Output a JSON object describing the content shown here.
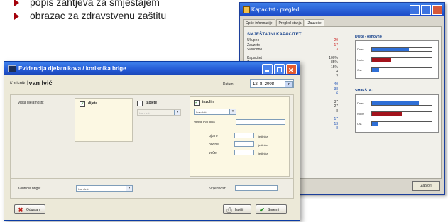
{
  "bullets": [
    "popis zahtjeva za smještajem",
    "obrazac za zdravstvenu zaštitu"
  ],
  "back_window": {
    "title": "Kapacitet - pregled",
    "tabs": [
      "Opće informacije",
      "Pregled stanja",
      "Zauzeće"
    ],
    "left_header": "SMJEŠTAJNI KAPACITET",
    "stats_group_1": [
      {
        "label": "Ukupno",
        "value": "20",
        "color": "red"
      },
      {
        "label": "Zauzeto",
        "value": "17",
        "color": "red"
      },
      {
        "label": "Slobodno",
        "value": "3",
        "color": "red"
      }
    ],
    "stats_group_2": [
      {
        "label": "Kapacitet",
        "value": "100%"
      },
      {
        "label": "Zauzeće",
        "value": "85%"
      },
      {
        "label": "Slobodno",
        "value": "15%"
      },
      {
        "label": "Na čekanju",
        "value": "4"
      },
      {
        "label": "Otpušteno",
        "value": "2"
      }
    ],
    "stats_group_3": [
      {
        "label": "Muškarci",
        "value": "40",
        "color": "blue"
      },
      {
        "label": "Žene",
        "value": "38",
        "color": "blue"
      },
      {
        "label": "Djeca",
        "value": "6",
        "color": "blue"
      }
    ],
    "stats_group_4": [
      {
        "label": "Zaposleni",
        "value": "37"
      },
      {
        "label": "Aktivni",
        "value": "27"
      },
      {
        "label": "Ostali",
        "value": "8"
      }
    ],
    "stats_group_5": [
      {
        "label": "Skupina A",
        "value": "17",
        "color": "blue"
      },
      {
        "label": "Skupina B",
        "value": "13",
        "color": "blue"
      },
      {
        "label": "Skupina C",
        "value": "8",
        "color": "blue"
      }
    ],
    "chart1_title": "DOBI - osnovno",
    "chart2_title": "SMJEŠTAJ",
    "chart1_bars": [
      {
        "label": "Dnev.",
        "fraction": 0.62,
        "color": "#2f6fd6"
      },
      {
        "label": "Noćni",
        "fraction": 0.32,
        "color": "#a3131c"
      },
      {
        "label": "Ost.",
        "fraction": 0.12,
        "color": "#2f6fd6"
      }
    ],
    "chart2_bars": [
      {
        "label": "Dnev.",
        "fraction": 0.78,
        "color": "#2f6fd6"
      },
      {
        "label": "Noćni",
        "fraction": 0.5,
        "color": "#a3131c"
      },
      {
        "label": "Ost.",
        "fraction": 0.1,
        "color": "#2f6fd6"
      }
    ],
    "close_button": "Zatvori"
  },
  "front_window": {
    "title": "Evidencija djelatnikova / korisnika brige",
    "korisnik_label": "Korisnik:",
    "korisnik_name": "Ivan Ivić",
    "datum_label": "Datum:",
    "datum_value": "12. 8. 2008",
    "vrsta_label": "Vrsta djelatnosti:",
    "options": [
      {
        "label": "dijeta",
        "checked": true
      },
      {
        "label": "tablete",
        "checked": false
      },
      {
        "label": "inzulin",
        "checked": true
      }
    ],
    "tablete_select": "Ivan Ivić",
    "inzulin_select": "Ivan Ivić",
    "vrsta_inzulina_label": "Vrsta inzulina",
    "doses": [
      {
        "label": "ujutro",
        "unit": "jedinica"
      },
      {
        "label": "podne",
        "unit": "jedinica"
      },
      {
        "label": "večer",
        "unit": "jedinica"
      }
    ],
    "kontrola_label": "Kontrola brige:",
    "kontrola_select": "Ivan Ivić",
    "vrijednost_label": "Vrijednost:",
    "cancel_button": "Odustani",
    "print_button": "Ispiši",
    "save_button": "Spremi"
  },
  "colors": {
    "title_bar": "#2358d4",
    "accent_red": "#a3131c",
    "accent_blue": "#2f6fd6",
    "bullet": "#a3000a"
  }
}
